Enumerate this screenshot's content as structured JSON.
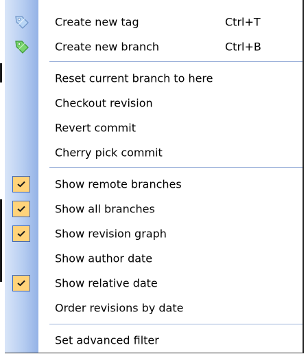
{
  "menu": {
    "items": [
      {
        "label": "Create new tag",
        "shortcut": "Ctrl+T",
        "icon": "tag-blue-icon",
        "checked": null
      },
      {
        "label": "Create new branch",
        "shortcut": "Ctrl+B",
        "icon": "tag-green-icon",
        "checked": null
      },
      {
        "label": "Reset current branch to here",
        "shortcut": "",
        "icon": null,
        "checked": null
      },
      {
        "label": "Checkout revision",
        "shortcut": "",
        "icon": null,
        "checked": null
      },
      {
        "label": "Revert commit",
        "shortcut": "",
        "icon": null,
        "checked": null
      },
      {
        "label": "Cherry pick commit",
        "shortcut": "",
        "icon": null,
        "checked": null
      },
      {
        "label": "Show remote branches",
        "shortcut": "",
        "icon": null,
        "checked": true
      },
      {
        "label": "Show all branches",
        "shortcut": "",
        "icon": null,
        "checked": true
      },
      {
        "label": "Show revision graph",
        "shortcut": "",
        "icon": null,
        "checked": true
      },
      {
        "label": "Show author date",
        "shortcut": "",
        "icon": null,
        "checked": false
      },
      {
        "label": "Show relative date",
        "shortcut": "",
        "icon": null,
        "checked": true
      },
      {
        "label": "Order revisions by date",
        "shortcut": "",
        "icon": null,
        "checked": false
      },
      {
        "label": "Set advanced filter",
        "shortcut": "",
        "icon": null,
        "checked": null
      }
    ]
  },
  "colors": {
    "gutter_light": "#d9e5f8",
    "gutter_dark": "#94b2e6",
    "checkbox_fill": "#ffd37a",
    "checkbox_border": "#3a64b8",
    "separator": "#9db2da",
    "tag_blue": "#9ec3ee",
    "tag_green": "#6fcf6a"
  }
}
